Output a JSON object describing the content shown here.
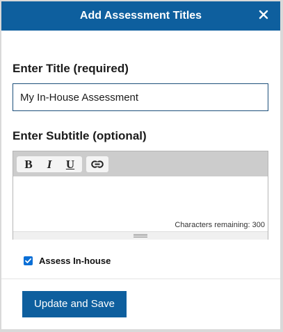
{
  "dialog": {
    "title": "Add Assessment Titles",
    "close_icon": "close-icon"
  },
  "title_field": {
    "label": "Enter Title (required)",
    "value": "My In-House Assessment"
  },
  "subtitle_field": {
    "label": "Enter Subtitle (optional)",
    "value": "",
    "toolbar": {
      "bold_label": "B",
      "italic_label": "I",
      "underline_label": "U",
      "link_icon": "link-icon"
    },
    "characters_remaining": "Characters remaining: 300"
  },
  "assess_in_house": {
    "label": "Assess In-house",
    "checked": true
  },
  "footer": {
    "save_label": "Update and Save"
  },
  "colors": {
    "header_bg": "#0e5f9e",
    "button_bg": "#0e5f9e",
    "checkbox": "#0b6fd6"
  }
}
